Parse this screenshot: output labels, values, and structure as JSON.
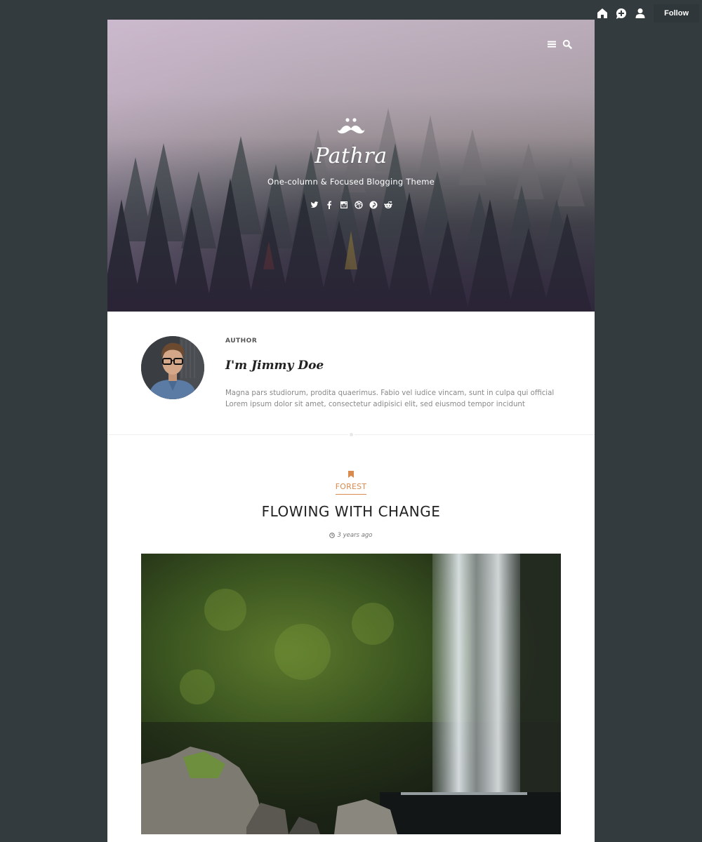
{
  "topbar": {
    "icons": [
      "home-icon",
      "add-post-icon",
      "user-icon"
    ],
    "follow_label": "Follow"
  },
  "hero": {
    "nav_icons": [
      "menu-icon",
      "search-icon"
    ],
    "site_title": "Pathra",
    "tagline": "One-column & Focused Blogging Theme",
    "social": [
      "twitter",
      "facebook",
      "instagram",
      "dribbble",
      "pinterest",
      "reddit"
    ]
  },
  "author": {
    "label": "AUTHOR",
    "name": "I'm Jimmy Doe",
    "bio": "Magna pars studiorum, prodita quaerimus. Fabio vel iudice vincam, sunt in culpa qui official Lorem ipsum dolor sit amet, consectetur adipisici elit, sed eiusmod tempor incidunt"
  },
  "post": {
    "category": "FOREST",
    "title": "FLOWING WITH CHANGE",
    "date": "3 years ago",
    "image_alt": "Waterfall over moss-covered rock wall"
  },
  "colors": {
    "accent": "#d98a4e",
    "background": "#343b3e",
    "text_dark": "#222222",
    "text_muted": "#888888"
  }
}
